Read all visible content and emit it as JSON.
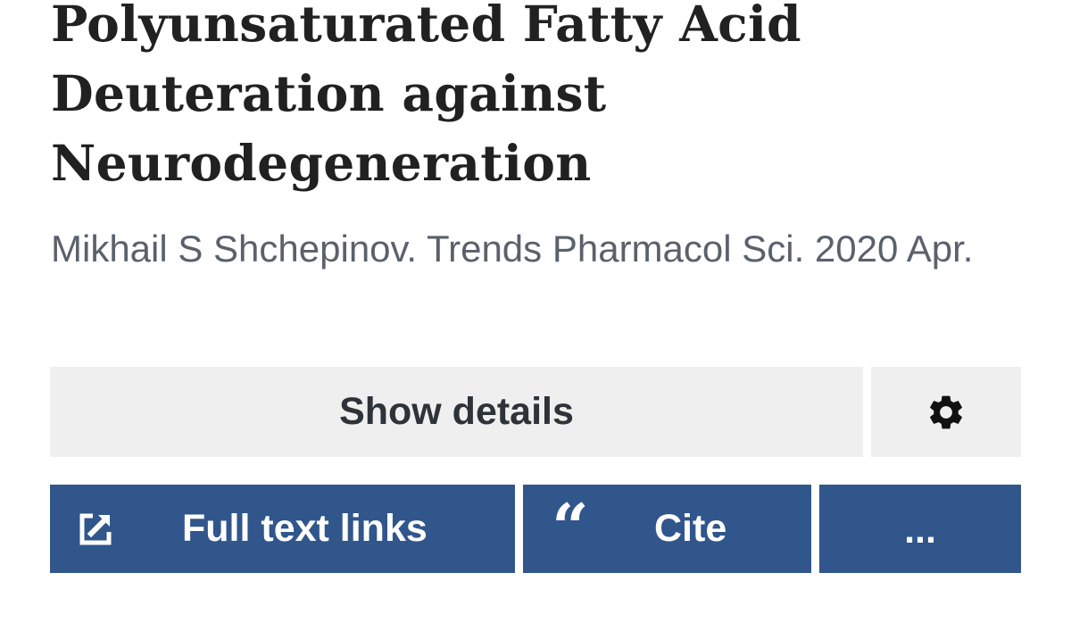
{
  "article": {
    "title": "Polyunsaturated Fatty Acid Deuteration against Neurodegeneration",
    "citation": "Mikhail S Shchepinov. Trends Pharmacol Sci. 2020 Apr."
  },
  "actions": {
    "show_details_label": "Show details",
    "settings_icon": "gear-icon",
    "full_text_label": "Full text links",
    "full_text_icon": "external-link-icon",
    "cite_label": "Cite",
    "cite_icon": "“",
    "more_label": "..."
  },
  "colors": {
    "primary_button": "#30568b",
    "secondary_button": "#efefef",
    "title_text": "#212121",
    "citation_text": "#5b616b"
  }
}
